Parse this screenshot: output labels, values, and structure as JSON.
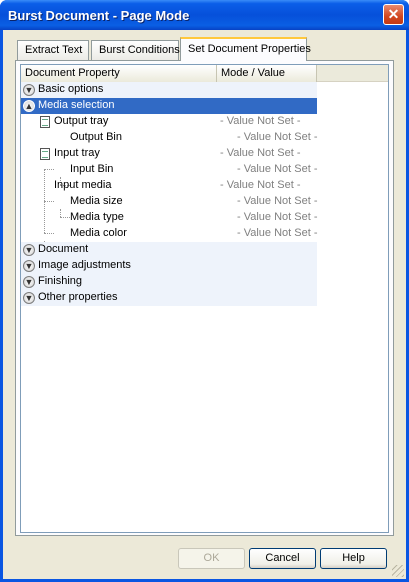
{
  "window": {
    "title": "Burst Document - Page Mode",
    "close_glyph": "✕"
  },
  "tabs": [
    {
      "label": "Extract Text",
      "active": false
    },
    {
      "label": "Burst Conditions",
      "active": false
    },
    {
      "label": "Set Document Properties",
      "active": true
    }
  ],
  "table": {
    "columns": [
      "Document Property",
      "Mode / Value"
    ],
    "rows": [
      {
        "label": "Basic options",
        "value": "",
        "type": "group",
        "expander": "down"
      },
      {
        "label": "Media selection",
        "value": "",
        "type": "group",
        "expander": "up",
        "selected": true
      },
      {
        "label": "Output tray",
        "value": "- Value Not Set -",
        "type": "item",
        "icon": "page-icon"
      },
      {
        "label": "Output Bin",
        "value": "- Value Not Set -",
        "type": "subitem"
      },
      {
        "label": "Input tray",
        "value": "- Value Not Set -",
        "type": "item",
        "icon": "page-icon"
      },
      {
        "label": "Input Bin",
        "value": "- Value Not Set -",
        "type": "subitem"
      },
      {
        "label": "Input media",
        "value": "- Value Not Set -",
        "type": "item"
      },
      {
        "label": "Media size",
        "value": "- Value Not Set -",
        "type": "subitem"
      },
      {
        "label": "Media type",
        "value": "- Value Not Set -",
        "type": "subitem"
      },
      {
        "label": "Media color",
        "value": "- Value Not Set -",
        "type": "subitem"
      },
      {
        "label": "Document",
        "value": "",
        "type": "group",
        "expander": "down"
      },
      {
        "label": "Image adjustments",
        "value": "",
        "type": "group",
        "expander": "down"
      },
      {
        "label": "Finishing",
        "value": "",
        "type": "group",
        "expander": "down"
      },
      {
        "label": "Other properties",
        "value": "",
        "type": "group",
        "expander": "down"
      }
    ]
  },
  "buttons": {
    "ok": {
      "label": "OK",
      "enabled": false
    },
    "cancel": {
      "label": "Cancel",
      "enabled": true
    },
    "help": {
      "label": "Help",
      "enabled": true
    }
  },
  "colors": {
    "titlebar": "#0650da",
    "selection": "#316ac5",
    "tab_highlight": "#ffc83c",
    "value_text": "#808080"
  }
}
